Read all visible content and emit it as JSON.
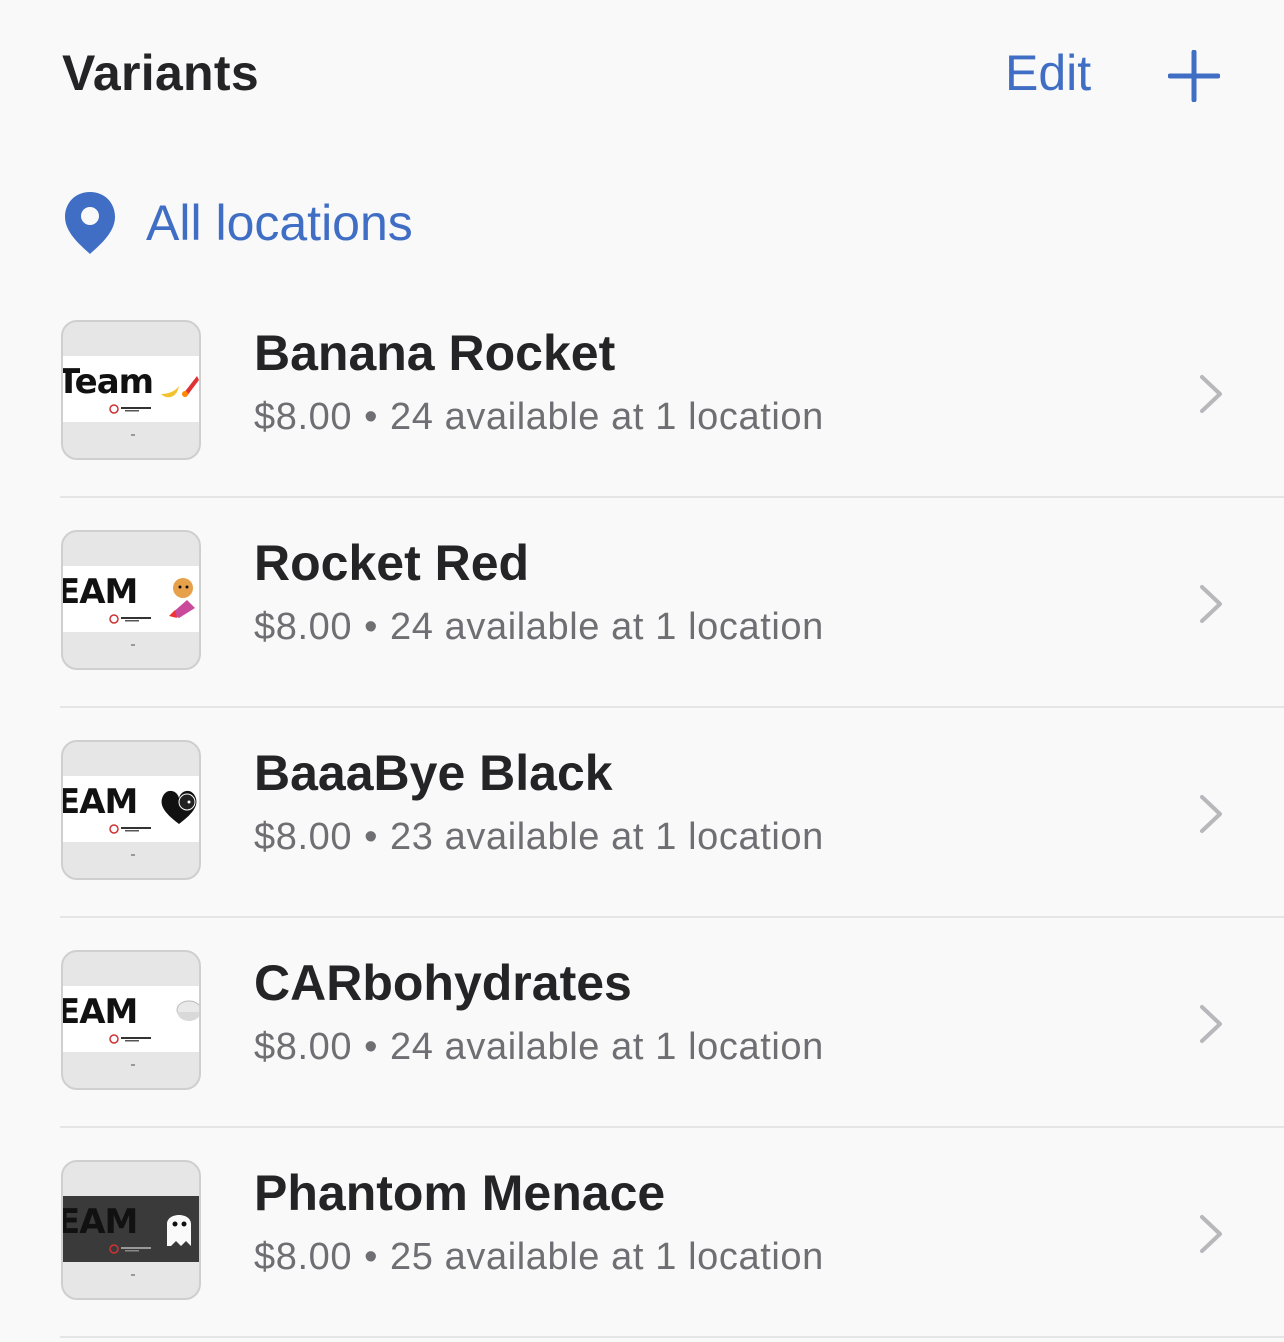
{
  "header": {
    "title": "Variants",
    "edit_label": "Edit",
    "add_icon": "plus-icon"
  },
  "location_filter": {
    "icon": "map-pin-icon",
    "label": "All locations"
  },
  "colors": {
    "accent": "#3f6ec4",
    "text_primary": "#242426",
    "text_secondary": "#6e6e73",
    "background": "#f9f9f9"
  },
  "variants": [
    {
      "name": "Banana Rocket",
      "price": "$8.00",
      "separator": "•",
      "availability": "24 available at 1 location",
      "thumb_word": "Team",
      "thumb_art": "banana-rocket-art"
    },
    {
      "name": "Rocket Red",
      "price": "$8.00",
      "separator": "•",
      "availability": "24 available at 1 location",
      "thumb_word": "EAM",
      "thumb_art": "shiba-rocket-art"
    },
    {
      "name": "BaaaBye Black",
      "price": "$8.00",
      "separator": "•",
      "availability": "23 available at 1 location",
      "thumb_word": "EAM",
      "thumb_art": "black-sheep-heart-art"
    },
    {
      "name": "CARbohydrates",
      "price": "$8.00",
      "separator": "•",
      "availability": "24 available at 1 location",
      "thumb_word": "EAM",
      "thumb_art": "rice-bowl-art"
    },
    {
      "name": "Phantom Menace",
      "price": "$8.00",
      "separator": "•",
      "availability": "25 available at 1 location",
      "thumb_word": "EAM",
      "thumb_art": "ghost-art"
    }
  ]
}
